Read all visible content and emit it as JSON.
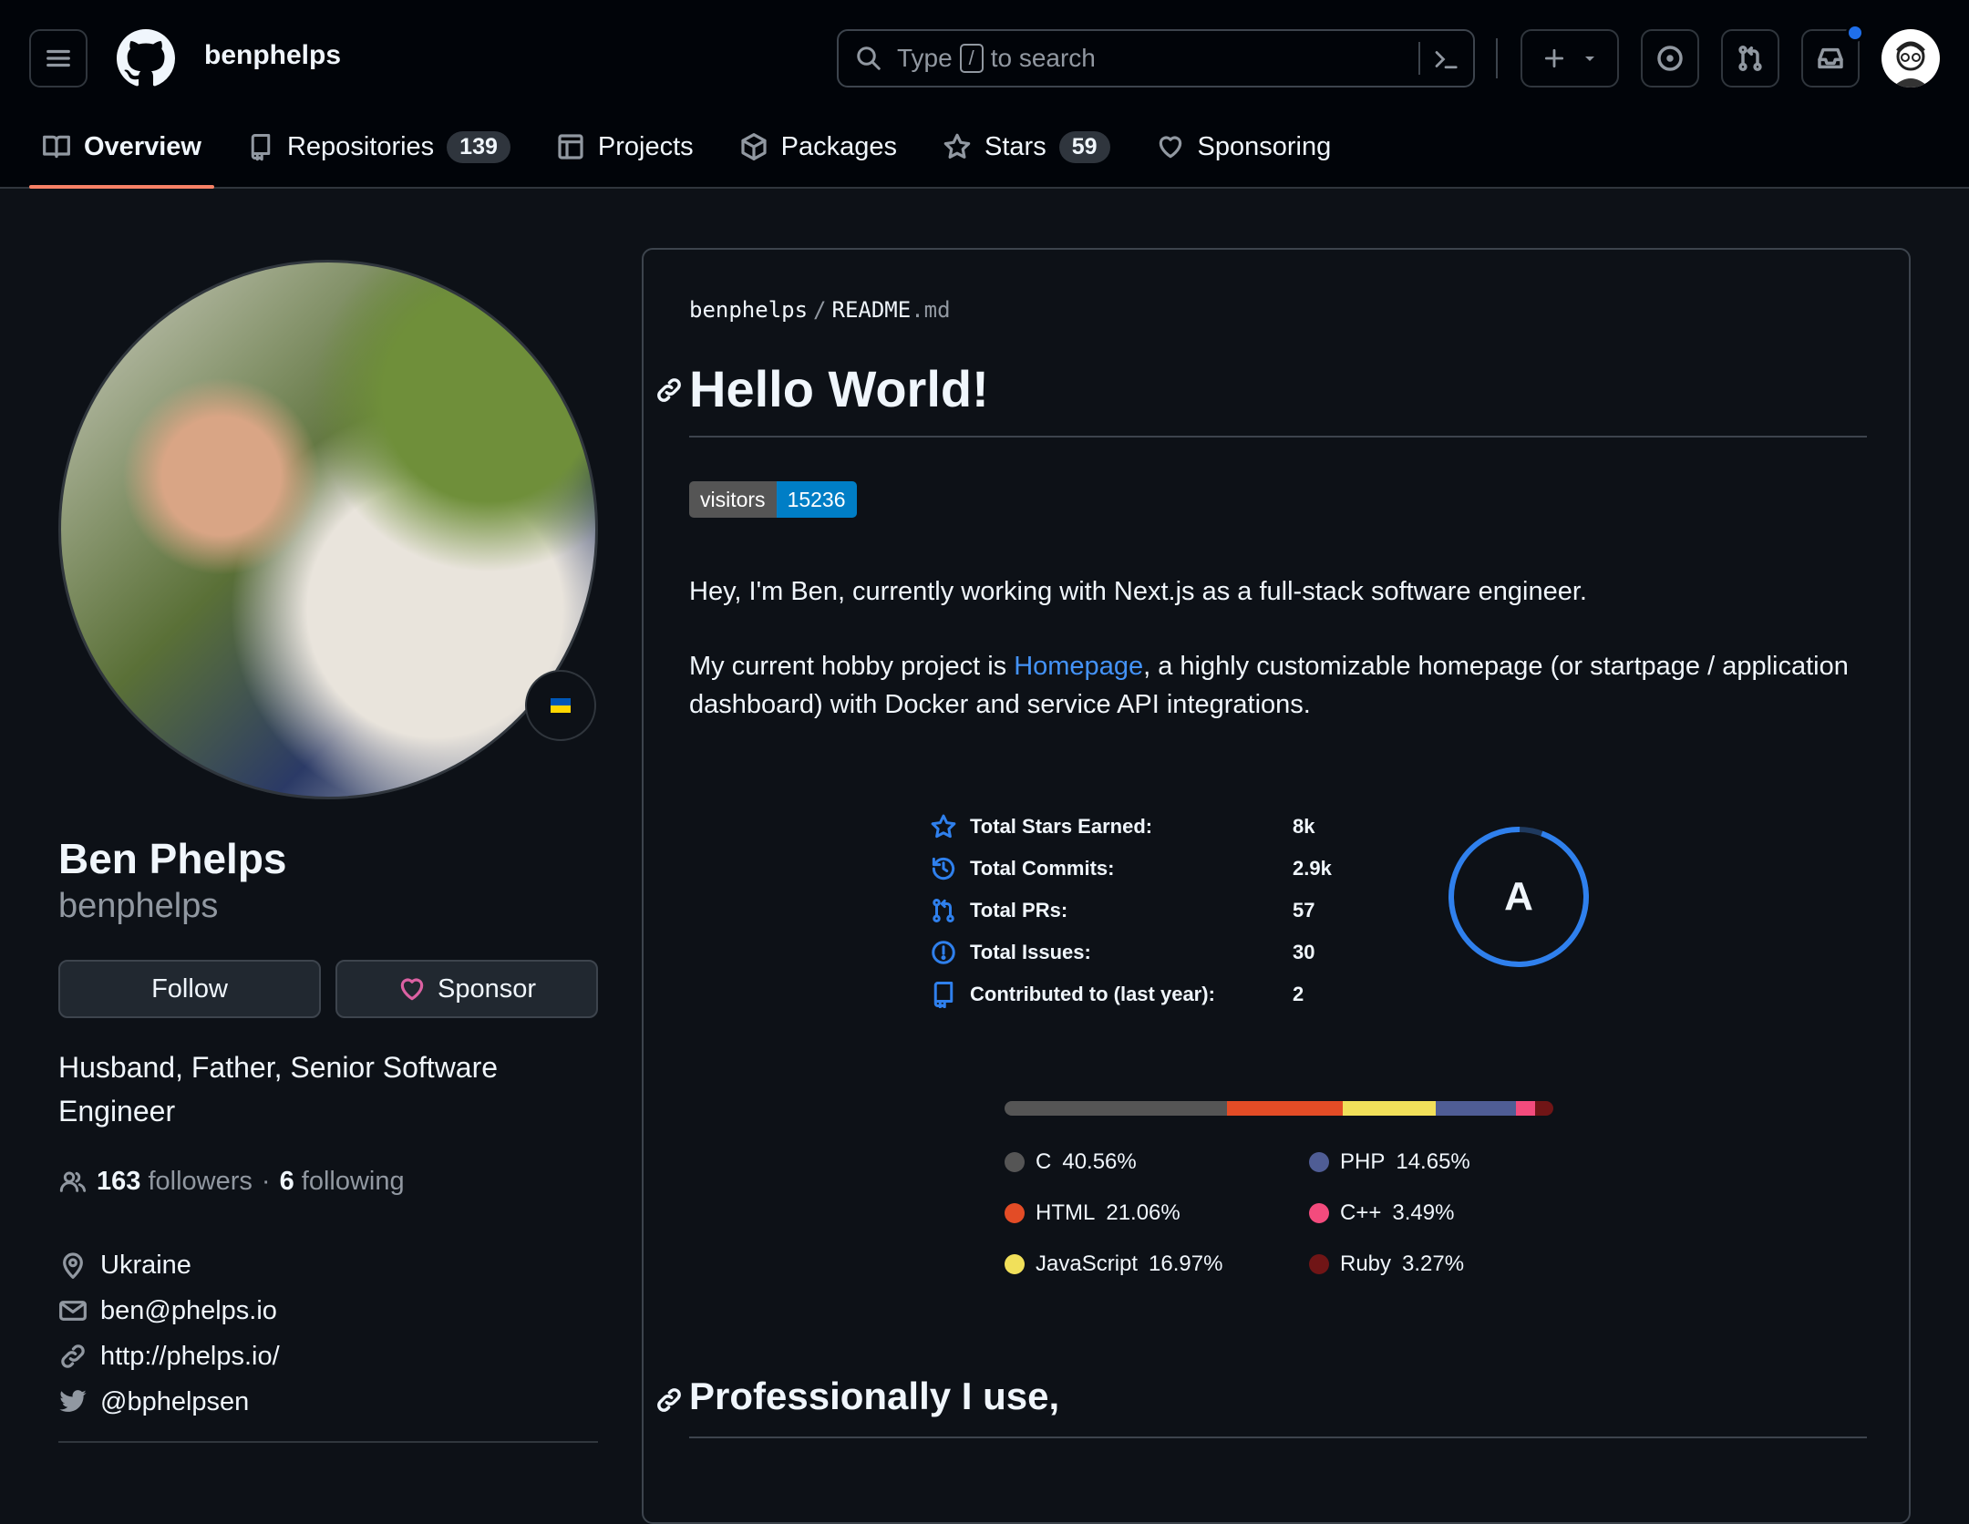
{
  "header": {
    "username": "benphelps",
    "search": {
      "prefix": "Type",
      "key": "/",
      "suffix": "to search"
    }
  },
  "nav": {
    "tabs": [
      {
        "label": "Overview"
      },
      {
        "label": "Repositories",
        "count": "139"
      },
      {
        "label": "Projects"
      },
      {
        "label": "Packages"
      },
      {
        "label": "Stars",
        "count": "59"
      },
      {
        "label": "Sponsoring"
      }
    ]
  },
  "profile": {
    "name": "Ben Phelps",
    "login": "benphelps",
    "follow_label": "Follow",
    "sponsor_label": "Sponsor",
    "bio": "Husband, Father, Senior Software Engineer",
    "followers_count": "163",
    "followers_label": "followers",
    "following_count": "6",
    "following_label": "following",
    "separator": "·",
    "location": "Ukraine",
    "email": "ben@phelps.io",
    "website": "http://phelps.io/",
    "twitter": "@bphelpsen"
  },
  "readme": {
    "path_owner": "benphelps",
    "path_file": "README",
    "path_ext": ".md",
    "heading1": "Hello World!",
    "badge_label": "visitors",
    "badge_value": "15236",
    "intro": "Hey, I'm Ben, currently working with Next.js as a full-stack software engineer.",
    "hobby_prefix": "My current hobby project is ",
    "hobby_link": "Homepage",
    "hobby_suffix": ", a highly customizable homepage (or startpage / application dashboard) with Docker and service API integrations.",
    "heading2": "Professionally I use,"
  },
  "stats": {
    "rows": [
      {
        "icon": "star-icon",
        "label": "Total Stars Earned:",
        "value": "8k"
      },
      {
        "icon": "history-icon",
        "label": "Total Commits:",
        "value": "2.9k"
      },
      {
        "icon": "pull-request-icon",
        "label": "Total PRs:",
        "value": "57"
      },
      {
        "icon": "issue-icon",
        "label": "Total Issues:",
        "value": "30"
      },
      {
        "icon": "repo-icon",
        "label": "Contributed to (last year):",
        "value": "2"
      }
    ],
    "rank": "A",
    "rank_ring_color": "#2f80ed"
  },
  "languages": [
    {
      "name": "C",
      "percent": "40.56%",
      "value": 40.56,
      "color": "#555555"
    },
    {
      "name": "HTML",
      "percent": "21.06%",
      "value": 21.06,
      "color": "#e34c26"
    },
    {
      "name": "JavaScript",
      "percent": "16.97%",
      "value": 16.97,
      "color": "#f1e05a"
    },
    {
      "name": "PHP",
      "percent": "14.65%",
      "value": 14.65,
      "color": "#4f5d95"
    },
    {
      "name": "C++",
      "percent": "3.49%",
      "value": 3.49,
      "color": "#f34b7d"
    },
    {
      "name": "Ruby",
      "percent": "3.27%",
      "value": 3.27,
      "color": "#701516"
    }
  ],
  "colors": {
    "accent": "#f78166",
    "link": "#4493f8",
    "notification_dot": "#1f6feb"
  }
}
